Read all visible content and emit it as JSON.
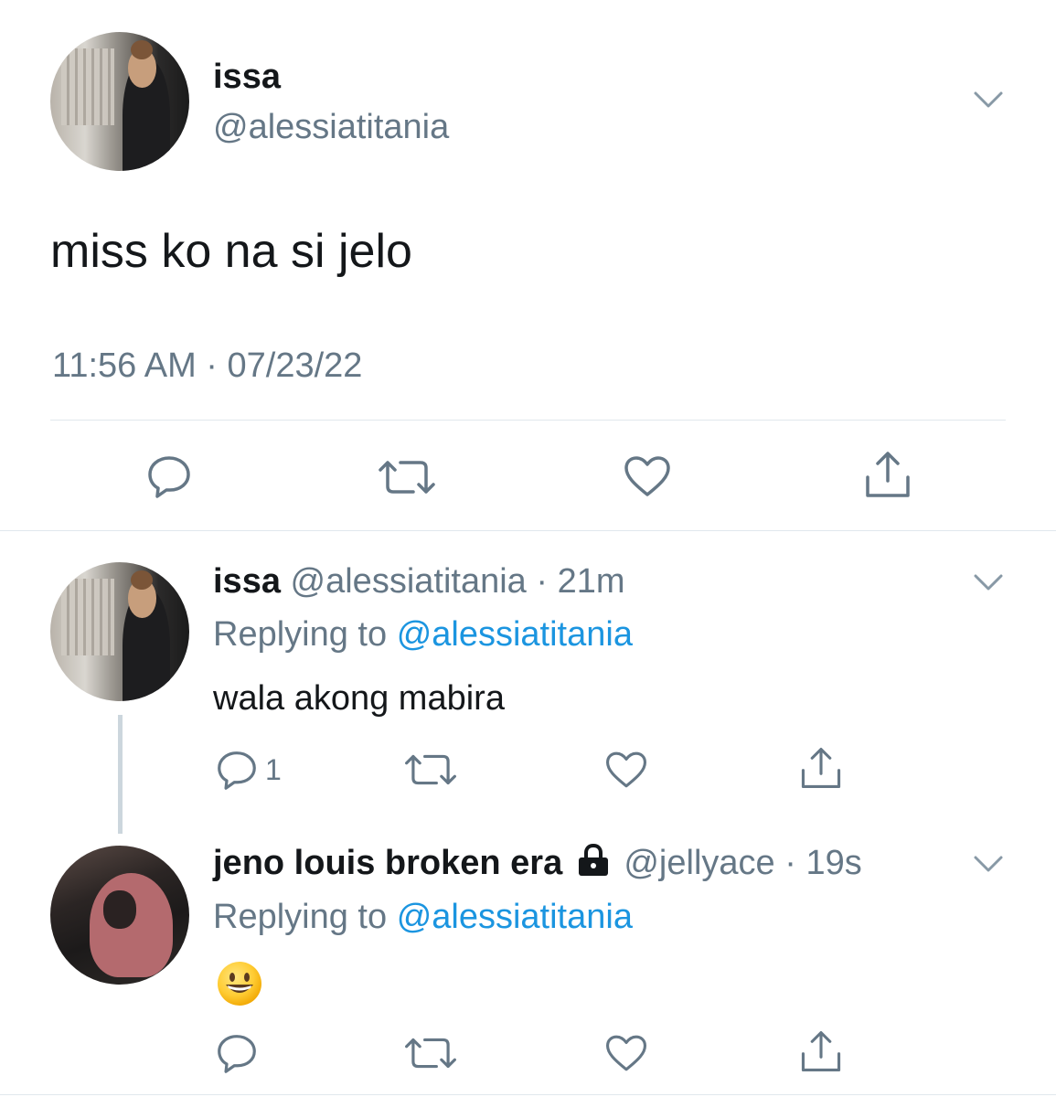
{
  "main_tweet": {
    "name": "issa",
    "handle": "@alessiatitania",
    "text": "miss ko na si jelo",
    "timestamp": "11:56 AM · 07/23/22"
  },
  "replies": [
    {
      "name": "issa",
      "handle": "@alessiatitania",
      "time": "21m",
      "replying_label": "Replying to",
      "replying_to": "@alessiatitania",
      "text": "wala akong mabira",
      "reply_count": "1"
    },
    {
      "name": "jeno louis broken era",
      "handle": "@jellyace",
      "time": "19s",
      "replying_label": "Replying to",
      "replying_to": "@alessiatitania",
      "text": "😀",
      "reply_count": ""
    }
  ],
  "icons": {
    "reply": "reply-icon",
    "retweet": "retweet-icon",
    "like": "like-icon",
    "share": "share-icon",
    "more": "chevron-down-icon",
    "lock": "lock-icon"
  },
  "colors": {
    "link": "#1b95e0",
    "muted": "#657786",
    "divider": "#e1e8ed"
  }
}
